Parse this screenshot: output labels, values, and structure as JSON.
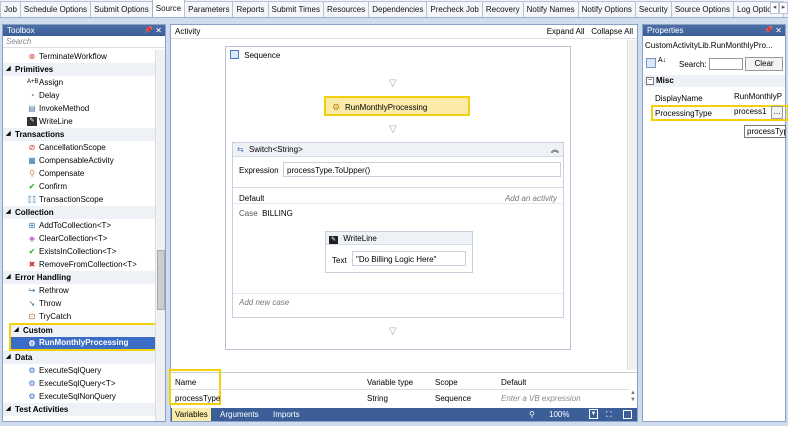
{
  "tabs": [
    "Job",
    "Schedule Options",
    "Submit Options",
    "Source",
    "Parameters",
    "Reports",
    "Submit Times",
    "Resources",
    "Dependencies",
    "Precheck Job",
    "Recovery",
    "Notify Names",
    "Notify Options",
    "Security",
    "Source Options",
    "Log Options"
  ],
  "toolbox": {
    "title": "Toolbox",
    "search_placeholder": "Search",
    "top_item": "TerminateWorkflow",
    "categories": [
      {
        "name": "Primitives",
        "items": [
          "Assign",
          "Delay",
          "InvokeMethod",
          "WriteLine"
        ]
      },
      {
        "name": "Transactions",
        "items": [
          "CancellationScope",
          "CompensableActivity",
          "Compensate",
          "Confirm",
          "TransactionScope"
        ]
      },
      {
        "name": "Collection",
        "items": [
          "AddToCollection<T>",
          "ClearCollection<T>",
          "ExistsInCollection<T>",
          "RemoveFromCollection<T>"
        ]
      },
      {
        "name": "Error Handling",
        "items": [
          "Rethrow",
          "Throw",
          "TryCatch"
        ]
      },
      {
        "name": "Custom",
        "items": [
          "RunMonthlyProcessing"
        ]
      },
      {
        "name": "Data",
        "items": [
          "ExecuteSqlQuery",
          "ExecuteSqlQuery<T>",
          "ExecuteSqlNonQuery"
        ]
      },
      {
        "name": "Test Activities",
        "items": []
      }
    ],
    "assign_prefix": "A+B"
  },
  "designer": {
    "title": "Activity",
    "expand_all": "Expand All",
    "collapse_all": "Collapse All",
    "sequence_label": "Sequence",
    "run_activity": "RunMonthlyProcessing",
    "switch_label": "Switch<String>",
    "expression_label": "Expression",
    "expression_value": "processType.ToUpper()",
    "default_label": "Default",
    "add_activity": "Add an activity",
    "case_label": "Case",
    "case_value": "BILLING",
    "writeline_label": "WriteLine",
    "text_label": "Text",
    "text_value": "\"Do Billing Logic Here\"",
    "add_case": "Add new case"
  },
  "variables": {
    "headers": [
      "Name",
      "Variable type",
      "Scope",
      "Default"
    ],
    "row": {
      "name": "processType",
      "type": "String",
      "scope": "Sequence",
      "default_placeholder": "Enter a VB expression"
    },
    "tabs": [
      "Variables",
      "Arguments",
      "Imports"
    ],
    "zoom": "100%"
  },
  "properties": {
    "title": "Properties",
    "object": "CustomActivityLib.RunMonthlyPro...",
    "search_label": "Search:",
    "clear": "Clear",
    "section": "Misc",
    "rows": [
      {
        "name": "DisplayName",
        "value": "RunMonthlyP"
      },
      {
        "name": "ProcessingType",
        "value": "process1"
      }
    ],
    "tooltip": "processTyp"
  },
  "colors": {
    "highlight": "#f2d00a",
    "panel_header": "#3b5e98",
    "selection": "#3b6cc6"
  }
}
